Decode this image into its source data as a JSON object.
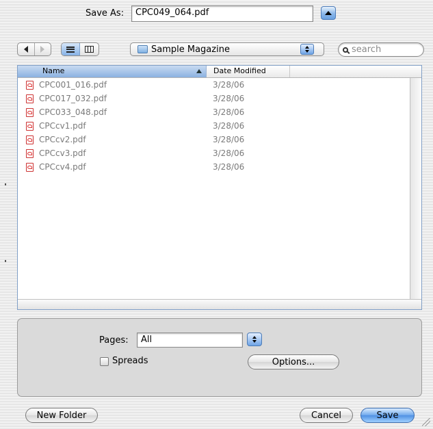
{
  "save_as": {
    "label": "Save As:",
    "filename": "CPC049_064.pdf"
  },
  "toolbar": {
    "folder": "Sample Magazine",
    "search_placeholder": "search"
  },
  "file_list": {
    "columns": {
      "name": "Name",
      "date": "Date Modified"
    },
    "sort_indicator": "ascending",
    "files": [
      {
        "name": "CPC001_016.pdf",
        "date": "3/28/06"
      },
      {
        "name": "CPC017_032.pdf",
        "date": "3/28/06"
      },
      {
        "name": "CPC033_048.pdf",
        "date": "3/28/06"
      },
      {
        "name": "CPCcv1.pdf",
        "date": "3/28/06"
      },
      {
        "name": "CPCcv2.pdf",
        "date": "3/28/06"
      },
      {
        "name": "CPCcv3.pdf",
        "date": "3/28/06"
      },
      {
        "name": "CPCcv4.pdf",
        "date": "3/28/06"
      }
    ]
  },
  "options": {
    "pages_label": "Pages:",
    "pages_value": "All",
    "spreads_label": "Spreads",
    "spreads_checked": false,
    "options_button": "Options..."
  },
  "buttons": {
    "new_folder": "New Folder",
    "cancel": "Cancel",
    "save": "Save"
  },
  "colors": {
    "accent": "#6ea8ec",
    "header_selected": "#8bb1e0",
    "dimmed_text": "#7a7a7a"
  }
}
